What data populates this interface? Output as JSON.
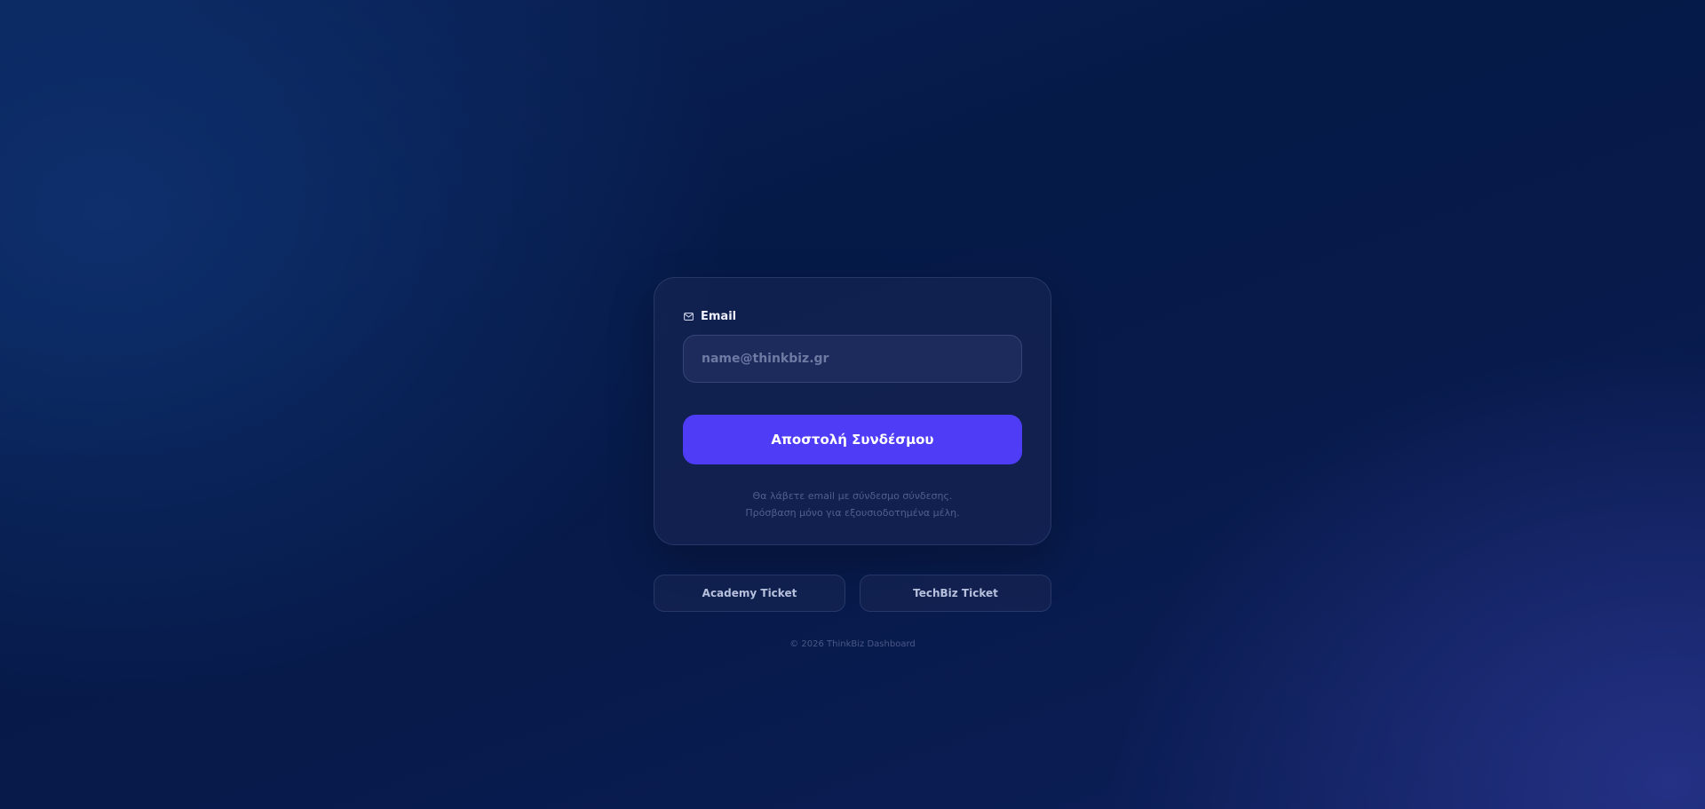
{
  "form": {
    "email_label": "Email",
    "email_icon": "mail-icon",
    "email_placeholder": "name@thinkbiz.gr",
    "email_value": "",
    "submit_label": "Αποστολή Συνδέσμου",
    "info_line_1": "Θα λάβετε email με σύνδεσμο σύνδεσης.",
    "info_line_2": "Πρόσβαση μόνο για εξουσιοδοτημένα μέλη."
  },
  "tickets": {
    "academy_label": "Academy Ticket",
    "techbiz_label": "TechBiz Ticket"
  },
  "footer": {
    "copyright": "© 2026 ThinkBiz Dashboard"
  },
  "colors": {
    "accent": "#4f3cf6",
    "background": "#071a4a"
  }
}
